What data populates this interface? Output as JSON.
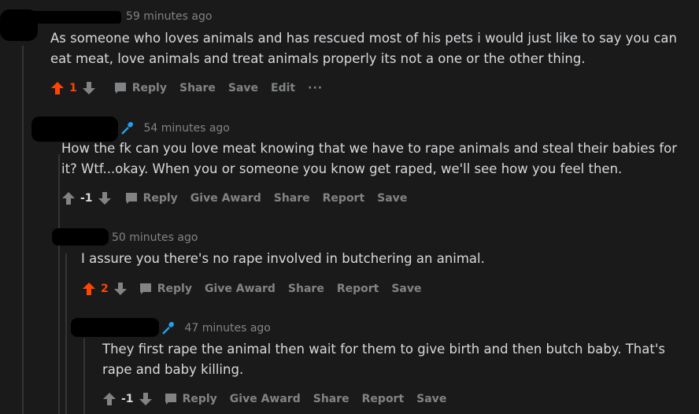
{
  "colors": {
    "background": "#1a1a1b",
    "text": "#d7dadc",
    "muted": "#818384",
    "upvote": "#ff4500",
    "mic": "#24a0ed"
  },
  "comments": [
    {
      "timestamp": "59 minutes ago",
      "body": "As someone who loves animals and has rescued most of his pets i would just like to say you can eat meat, love animals and treat animals properly its not a one or the other thing.",
      "score": "1",
      "actions": {
        "reply": "Reply",
        "share": "Share",
        "save": "Save",
        "edit": "Edit",
        "more": "···"
      }
    },
    {
      "timestamp": "54 minutes ago",
      "body": "How the fk can you love meat knowing that we have to rape animals and steal their babies for it? Wtf...okay. When you or someone you know get raped, we'll see how you feel then.",
      "score": "-1",
      "actions": {
        "reply": "Reply",
        "award": "Give Award",
        "share": "Share",
        "report": "Report",
        "save": "Save"
      }
    },
    {
      "timestamp": "50 minutes ago",
      "body": "I assure you there's no rape involved in butchering an animal.",
      "score": "2",
      "actions": {
        "reply": "Reply",
        "award": "Give Award",
        "share": "Share",
        "report": "Report",
        "save": "Save"
      }
    },
    {
      "timestamp": "47 minutes ago",
      "body": "They first rape the animal then wait for them to give birth and then butch baby. That's rape and baby killing.",
      "score": "-1",
      "actions": {
        "reply": "Reply",
        "award": "Give Award",
        "share": "Share",
        "report": "Report",
        "save": "Save"
      }
    }
  ]
}
